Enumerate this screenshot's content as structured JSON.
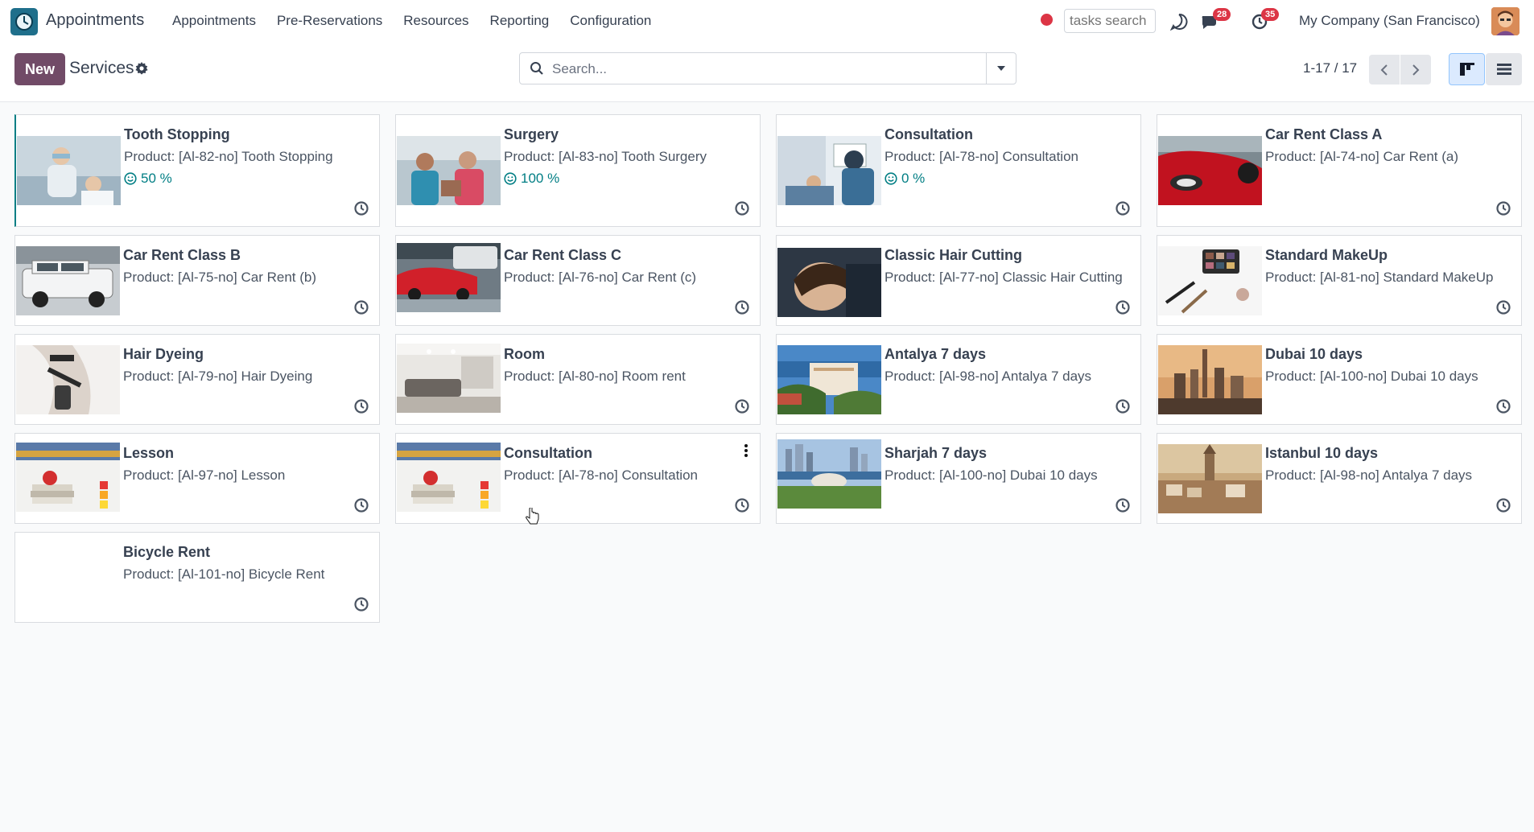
{
  "navbar": {
    "app_name": "Appointments",
    "menu": [
      "Appointments",
      "Pre-Reservations",
      "Resources",
      "Reporting",
      "Configuration"
    ],
    "tasks_search_placeholder": "tasks search",
    "messages_badge": "28",
    "activities_badge": "35",
    "company": "My Company (San Francisco)"
  },
  "control": {
    "new_label": "New",
    "title": "Services",
    "search_placeholder": "Search...",
    "pager": "1-17 / 17"
  },
  "colors": {
    "brand": "#714b67",
    "accent": "#017e84",
    "badge": "#dc3545"
  },
  "cards": [
    {
      "title": "Tooth Stopping",
      "product_label": "Product:",
      "product": "[Al-82-no] Tooth Stopping",
      "rating": "50 %",
      "image": "dentist-photo"
    },
    {
      "title": "Surgery",
      "product_label": "Product:",
      "product": "[Al-83-no] Tooth Surgery",
      "rating": "100 %",
      "image": "dental-surgery-photo"
    },
    {
      "title": "Consultation",
      "product_label": "Product:",
      "product": "[Al-78-no] Consultation",
      "rating": "0 %",
      "image": "dental-consultation-photo"
    },
    {
      "title": "Car Rent Class A",
      "product_label": "Product:",
      "product": "[Al-74-no] Car Rent (a)",
      "image": "red-car-photo"
    },
    {
      "title": "Car Rent Class B",
      "product_label": "Product:",
      "product": "[Al-75-no] Car Rent (b)",
      "image": "white-suv-photo"
    },
    {
      "title": "Car Rent Class C",
      "product_label": "Product:",
      "product": "[Al-76-no] Car Rent (c)",
      "image": "parking-lot-photo"
    },
    {
      "title": "Classic Hair Cutting",
      "product_label": "Product:",
      "product": "[Al-77-no] Classic Hair Cutting",
      "image": "haircut-photo"
    },
    {
      "title": "Standard MakeUp",
      "product_label": "Product:",
      "product": "[Al-81-no] Standard MakeUp",
      "image": "makeup-photo"
    },
    {
      "title": "Hair Dyeing",
      "product_label": "Product:",
      "product": "[Al-79-no] Hair Dyeing",
      "image": "hair-dye-photo"
    },
    {
      "title": "Room",
      "product_label": "Product:",
      "product": "[Al-80-no] Room rent",
      "image": "room-photo"
    },
    {
      "title": "Antalya 7 days",
      "product_label": "Product:",
      "product": "[Al-98-no] Antalya 7 days",
      "image": "antalya-photo"
    },
    {
      "title": "Dubai 10 days",
      "product_label": "Product:",
      "product": "[Al-100-no] Dubai 10 days",
      "image": "dubai-photo"
    },
    {
      "title": "Lesson",
      "product_label": "Product:",
      "product": "[Al-97-no] Lesson",
      "image": "lesson-photo"
    },
    {
      "title": "Consultation",
      "product_label": "Product:",
      "product": "[Al-78-no] Consultation",
      "image": "lesson-photo"
    },
    {
      "title": "Sharjah 7 days",
      "product_label": "Product:",
      "product": "[Al-100-no] Dubai 10 days",
      "image": "sharjah-photo"
    },
    {
      "title": "Istanbul 10 days",
      "product_label": "Product:",
      "product": "[Al-98-no] Antalya 7 days",
      "image": "istanbul-photo"
    },
    {
      "title": "Bicycle Rent",
      "product_label": "Product:",
      "product": "[Al-101-no] Bicycle Rent",
      "image": "none"
    }
  ]
}
